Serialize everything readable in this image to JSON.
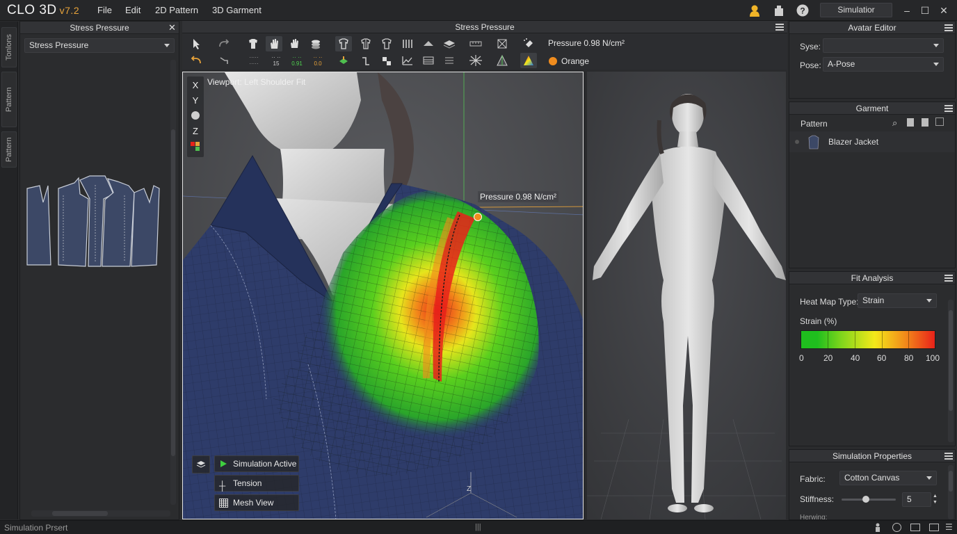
{
  "app": {
    "logo": "CLO 3D",
    "version": "v7.2"
  },
  "menu": {
    "items": [
      "File",
      "Edit",
      "2D Pattern",
      "3D Garment"
    ],
    "mode": "Simulatior"
  },
  "window_controls": {
    "minimize": "–",
    "maximize": "☐",
    "close": "✕"
  },
  "left_tabs": [
    "Tonlons",
    "Pattern",
    "Pattern"
  ],
  "left_panel": {
    "title": "Stress Pressure",
    "close": "✕",
    "dropdown_value": "Stress Pressure"
  },
  "center_panel": {
    "title": "Stress Pressure"
  },
  "toolbar": {
    "pressure_readout": "Pressure 0.98 N/cm²",
    "color_label": "Orange",
    "color_swatch": "#f08c1e",
    "number_labels": [
      "15",
      "0.91",
      "0.0"
    ]
  },
  "viewport": {
    "label": "Viewport: Left Shoulder Fit",
    "axes": [
      "X",
      "Y",
      "Z"
    ],
    "pressure_tooltip": "Pressure 0.98 N/cm²",
    "ground_axis": "Z",
    "overlay_buttons": {
      "simulation": "Simulation Active",
      "tension": "Tension",
      "mesh": "Mesh View"
    }
  },
  "avatar_editor": {
    "title": "Avatar Editor",
    "size_label": "Syse:",
    "size_value": "",
    "pose_label": "Pose:",
    "pose_value": "A-Pose"
  },
  "garment": {
    "title": "Garment",
    "column_label": "Pattern",
    "items": [
      {
        "name": "Blazer Jacket"
      }
    ]
  },
  "fit_analysis": {
    "title": "Fit Analysis",
    "heatmap_label": "Heat Map Type:",
    "heatmap_value": "Strain",
    "legend_title": "Strain (%)",
    "legend_ticks": [
      "0",
      "20",
      "40",
      "60",
      "80",
      "100"
    ],
    "legend_colors": [
      "#1fbe1e",
      "#f4e81a",
      "#f28a1a",
      "#e8221a"
    ]
  },
  "simulation_properties": {
    "title": "Simulation Properties",
    "fabric_label": "Fabric:",
    "fabric_value": "Cotton Canvas",
    "stiffness_label": "Stiffness:",
    "stiffness_value": "5",
    "stiffness_level": 0.45,
    "cut_label": "Herwing:"
  },
  "status": {
    "text": "Simulation Prsert",
    "center": "|||"
  },
  "colors": {
    "accent": "#e8a33a",
    "selection_border": "#e5e5e5",
    "pressure_point": "#f08c1e"
  }
}
